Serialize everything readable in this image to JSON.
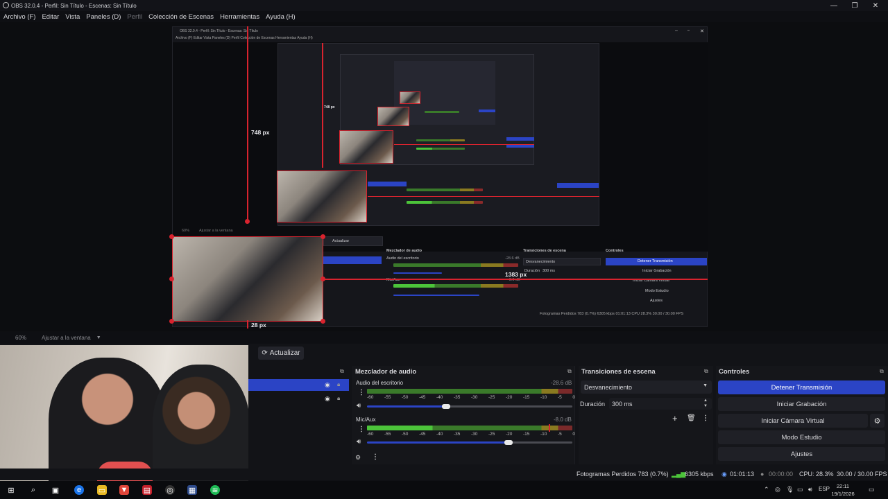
{
  "window": {
    "title": "OBS 32.0.4 - Perfil: Sin Título - Escenas: Sin Título",
    "minimize": "—",
    "maximize": "❐",
    "close": "✕"
  },
  "menu": {
    "items": [
      "Archivo (F)",
      "Editar",
      "Vista",
      "Paneles (D)",
      "Perfil",
      "Colección de Escenas",
      "Herramientas",
      "Ayuda (H)"
    ]
  },
  "preview": {
    "measure_vertical": "748 px",
    "measure_vertical_small": "748 px",
    "measure_horizontal": "1383 px",
    "measure_bottom": "28 px",
    "nested_title": "OBS 32.0.4 - Perfil: Sin Título - Escenas: Sin Título",
    "nested_menu": "Archivo (F)   Editar   Vista   Paneles (D)   Perfil   Colección de Escenas   Herramientas   Ayuda (H)",
    "nested_mixer": "Mezclador de audio",
    "nested_transitions": "Transiciones de escena",
    "nested_controls": "Controles",
    "nested_update": "Actualizar",
    "nested_stop": "Detener Transmisión",
    "nested_record": "Iniciar Grabación",
    "nested_vcam": "Iniciar Cámara Virtual",
    "nested_studio": "Modo Estudio",
    "nested_settings": "Ajustes",
    "nested_fade": "Desvanecimiento",
    "nested_duration": "Duración",
    "nested_duration_value": "300 ms",
    "nested_desktop": "Audio del escritorio",
    "nested_mic": "Mic/Aux",
    "nested_desktop_db": "-28.6 dB",
    "nested_mic_db": "-8.0 dB",
    "nested_status": "Fotogramas Perdidos 783 (0.7%)   6305 kbps   01:01:13   CPU 28.3%   30.00 / 30.00 FPS",
    "nested_zoom": "60%",
    "nested_fit": "Ajustar a la ventana"
  },
  "zoom": {
    "value": "60%",
    "fit_label": "Ajustar a la ventana"
  },
  "scenes": {
    "update_button": "Actualizar",
    "update_icon": "refresh-icon"
  },
  "mixer": {
    "title": "Mezclador de audio",
    "channels": [
      {
        "name": "Audio del escritorio",
        "db": "-28.6 dB",
        "level": 0.72,
        "volume": 0.39
      },
      {
        "name": "Mic/Aux",
        "db": "-8.0 dB",
        "level": 0.32,
        "volume": 0.7
      }
    ],
    "ticks": [
      "-60",
      "-55",
      "-50",
      "-45",
      "-40",
      "-35",
      "-30",
      "-25",
      "-20",
      "-15",
      "-10",
      "-5",
      "0"
    ]
  },
  "transitions": {
    "title": "Transiciones de escena",
    "selected": "Desvanecimiento",
    "duration_label": "Duración",
    "duration_value": "300 ms"
  },
  "controls": {
    "title": "Controles",
    "stop_stream": "Detener Transmisión",
    "start_recording": "Iniciar Grabación",
    "start_virtual_cam": "Iniciar Cámara Virtual",
    "studio_mode": "Modo Estudio",
    "settings": "Ajustes"
  },
  "status": {
    "dropped_frames": "Fotogramas Perdidos 783 (0.7%)",
    "bitrate": "6305 kbps",
    "stream_time": "01:01:13",
    "record_time": "00:00:00",
    "cpu": "CPU: 28.3%",
    "fps": "30.00 / 30.00 FPS"
  },
  "taskbar": {
    "language": "ESP",
    "time": "22:11",
    "date": "19/1/2026"
  },
  "colors": {
    "accent": "#2b44c5",
    "selection_red": "#d9232e",
    "meter_green": "#4cc43a",
    "meter_yellow": "#c9b22a",
    "meter_red": "#c83a3a"
  }
}
